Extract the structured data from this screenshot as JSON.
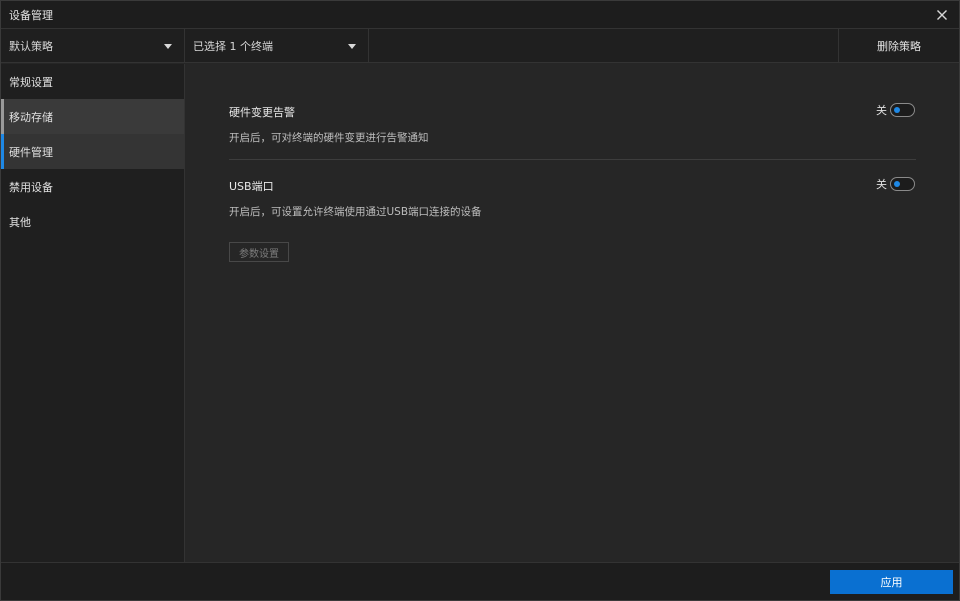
{
  "window": {
    "title": "设备管理"
  },
  "icons": {
    "close": "close-icon",
    "caret": "caret-down-icon"
  },
  "toolbar": {
    "policy_select": "默认策略",
    "terminal_select": "已选择 1 个终端",
    "delete_label": "删除策略"
  },
  "sidebar": {
    "items": [
      {
        "label": "常规设置",
        "state": "normal"
      },
      {
        "label": "移动存储",
        "state": "hover"
      },
      {
        "label": "硬件管理",
        "state": "active"
      },
      {
        "label": "禁用设备",
        "state": "normal"
      },
      {
        "label": "其他",
        "state": "normal"
      }
    ]
  },
  "settings": {
    "hardware_alert": {
      "title": "硬件变更告警",
      "description": "开启后，可对终端的硬件变更进行告警通知",
      "toggle_label": "关",
      "enabled": false
    },
    "usb_port": {
      "title": "USB端口",
      "description": "开启后，可设置允许终端使用通过USB端口连接的设备",
      "toggle_label": "关",
      "enabled": false,
      "param_button": "参数设置"
    }
  },
  "footer": {
    "apply_label": "应用"
  },
  "colors": {
    "accent": "#0a70d1",
    "toggle_knob": "#1e88e5",
    "background": "#262626",
    "sidebar_bg": "#1f1f1f"
  }
}
